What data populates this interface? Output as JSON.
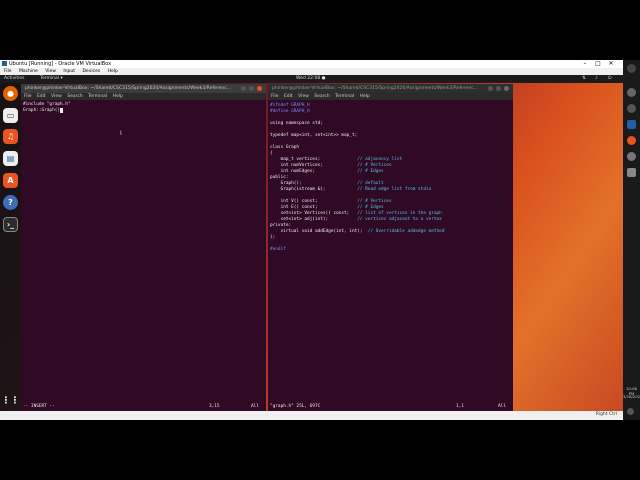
{
  "vbox": {
    "title": "Ubuntu [Running] - Oracle VM VirtualBox",
    "menus": [
      "File",
      "Machine",
      "View",
      "Input",
      "Devices",
      "Help"
    ],
    "host_key": "Right Ctrl"
  },
  "panel": {
    "activities": "Activities",
    "app_menu": "Terminal ▾",
    "clock": "Wed 22:08 ●"
  },
  "left_terminal": {
    "title": "phinker@phinker-VirtualBox: ~/Shared/CSC315/Spring2020/Assignments/Week3/Referenc...",
    "menus": [
      "File",
      "Edit",
      "View",
      "Search",
      "Terminal",
      "Help"
    ],
    "lines": [
      "#include \"graph.h\"",
      "",
      "Graph::Graph()"
    ],
    "status_mode": "-- INSERT --",
    "status_pos": "3,15",
    "status_all": "All"
  },
  "right_terminal": {
    "title": "phinker@phinker-VirtualBox: ~/Shared/CSC315/Spring2020/Assignments/Week3/Referenc...",
    "menus": [
      "File",
      "Edit",
      "View",
      "Search",
      "Terminal",
      "Help"
    ],
    "code": [
      "#ifndef GRAPH_H",
      "#define GRAPH_H",
      "",
      "using namespace std;",
      "",
      "typedef map<int, set<int>> map_t;",
      "",
      "class Graph",
      "{",
      "    map_t vertices;              // adjacency list",
      "    int numVertices;             // # Vertices",
      "    int numEdges;                // # Edges",
      "public:",
      "    Graph();                     // default",
      "    Graph(istream &);            // Read edge list from stdin",
      "",
      "    int V() const;               // # Vertices",
      "    int E() const;               // # Edges",
      "    set<int> Vertices() const;   // list of vertices in the graph",
      "    set<int> adj(int);           // vertices adjacent to a vertex",
      "private:",
      "    virtual void addEdge(int, int);  // Overridable addedge method",
      "};",
      "",
      "#endif"
    ],
    "status_file": "\"graph.h\" 25L, 697C",
    "status_pos": "1,1",
    "status_all": "All"
  },
  "tray": {
    "time": "10:08 PM",
    "date": "3/18/2020"
  },
  "colors": {
    "terminal_bg": "#300a24",
    "ubuntu_orange": "#e95420",
    "comment": "#4fc3e8",
    "preproc": "#7b8cff"
  }
}
